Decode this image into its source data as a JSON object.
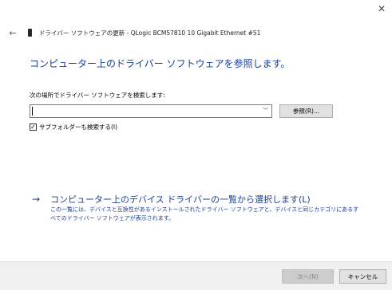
{
  "window": {
    "close_glyph": "✕",
    "back_glyph": "←",
    "title": "ドライバー ソフトウェアの更新 - QLogic BCM57810 10 Gigabit Ethernet #51"
  },
  "heading": "コンピューター上のドライバー ソフトウェアを参照します。",
  "search": {
    "label": "次の場所でドライバー ソフトウェアを検索します:",
    "path_value": "",
    "dropdown_glyph": "﹀",
    "browse_label": "参照(R)..."
  },
  "subfolders": {
    "checked": true,
    "check_glyph": "✓",
    "label": "サブフォルダーも検索する(I)"
  },
  "pick": {
    "arrow_glyph": "→",
    "link_text": "コンピューター上のデバイス ドライバーの一覧から選択します(L)",
    "description": "この一覧には、デバイスと互換性があるインストールされたドライバー ソフトウェアと、デバイスと同じカテゴリにあるすべてのドライバー ソフトウェアが表示されます。"
  },
  "footer": {
    "next_label": "次へ(N)",
    "cancel_label": "キャンセル"
  },
  "colors": {
    "accent": "#1a3e96",
    "footer_bg": "#f0f0f0",
    "button_bg": "#e1e1e1",
    "disabled_button_bg": "#cccccc"
  },
  "icons": [
    "close-icon",
    "back-arrow-icon",
    "network-adapter-icon",
    "chevron-down-icon",
    "checkmark-icon",
    "right-arrow-icon"
  ]
}
